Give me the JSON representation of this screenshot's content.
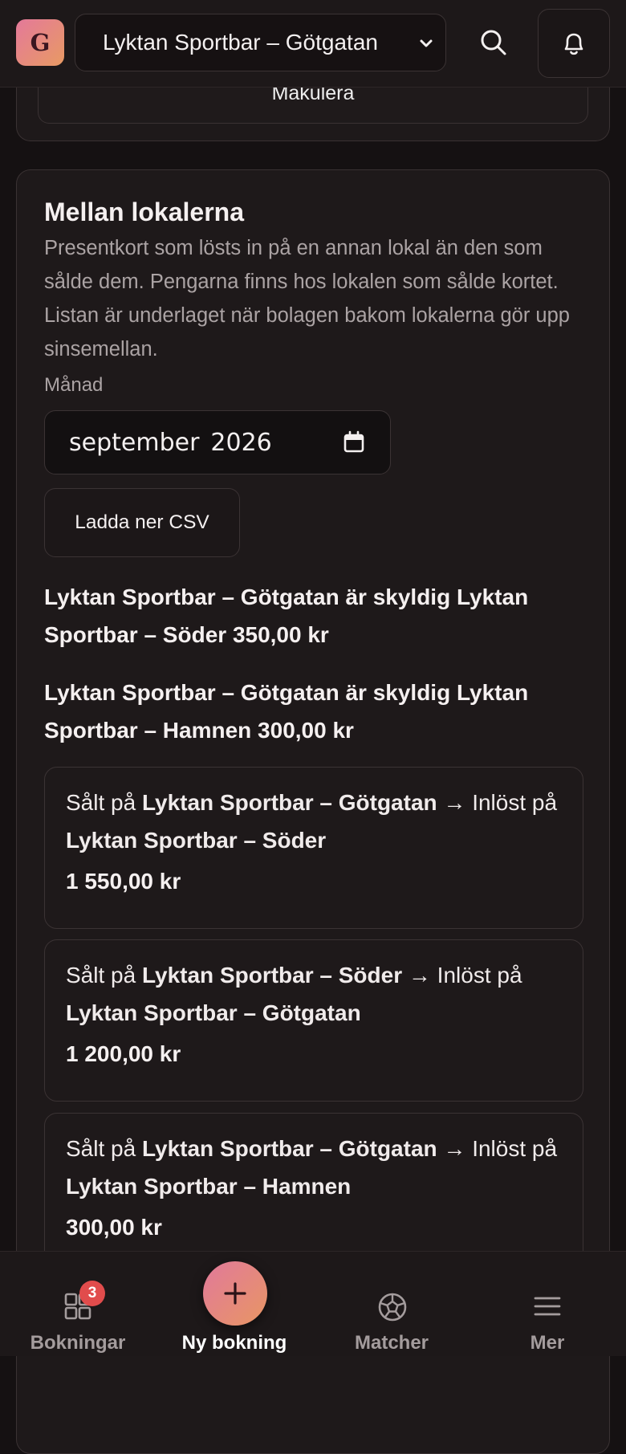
{
  "header": {
    "logo_letter": "G",
    "venue_selected": "Lyktan Sportbar – Götgatan",
    "icons": [
      "chevron-down-icon",
      "search-icon",
      "bell-icon"
    ]
  },
  "previous_card": {
    "button_label": "Makulera"
  },
  "inter_venue": {
    "title": "Mellan lokalerna",
    "description": "Presentkort som lösts in på en annan lokal än den som sålde dem. Pengarna finns hos lokalen som sålde kortet. Listan är underlaget när bolagen bakom lokalerna gör upp sinsemellan.",
    "month_label": "Månad",
    "month_value_month": "september",
    "month_value_year": "2026",
    "csv_button": "Ladda ner CSV",
    "debts": [
      "Lyktan Sportbar – Götgatan är skyldig Lyktan Sportbar – Söder 350,00 kr",
      "Lyktan Sportbar – Götgatan är skyldig Lyktan Sportbar – Hamnen 300,00 kr"
    ],
    "transactions": [
      {
        "sold_prefix": "Sålt på ",
        "sold_at": "Lyktan Sportbar – Götgatan",
        "redeemed_prefix": " → Inlöst på ",
        "redeemed_at": "Lyktan Sportbar – Söder",
        "amount": "1 550,00 kr"
      },
      {
        "sold_prefix": "Sålt på ",
        "sold_at": "Lyktan Sportbar – Söder",
        "redeemed_prefix": " → Inlöst på ",
        "redeemed_at": "Lyktan Sportbar – Götgatan",
        "amount": "1 200,00 kr"
      },
      {
        "sold_prefix": "Sålt på ",
        "sold_at": "Lyktan Sportbar – Götgatan",
        "redeemed_prefix": " → Inlöst på ",
        "redeemed_at": "Lyktan Sportbar – Hamnen",
        "amount": "300,00 kr"
      }
    ]
  },
  "bottom_nav": {
    "items": [
      {
        "label": "Bokningar",
        "icon": "grid-icon",
        "badge": "3"
      },
      {
        "label": "Ny bokning",
        "icon": "plus-icon",
        "active": true
      },
      {
        "label": "Matcher",
        "icon": "football-icon"
      },
      {
        "label": "Mer",
        "icon": "menu-icon"
      }
    ]
  },
  "colors": {
    "background": "#151112",
    "card": "#1e191a",
    "accent_gradient_start": "#e1799b",
    "accent_gradient_end": "#e89663",
    "badge": "#e14c4c",
    "muted_text": "#aba3a4"
  }
}
